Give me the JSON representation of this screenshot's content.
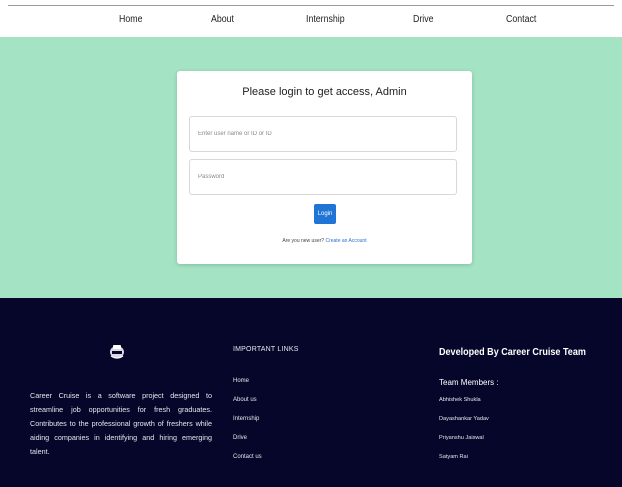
{
  "nav": {
    "items": [
      {
        "label": "Home"
      },
      {
        "label": "About"
      },
      {
        "label": "Internship"
      },
      {
        "label": "Drive"
      },
      {
        "label": "Contact"
      }
    ]
  },
  "login": {
    "title": "Please login to get access, Admin",
    "username_placeholder": "Enter user name or ID or ID",
    "password_placeholder": "Password",
    "button_label": "Login",
    "signup_prompt": "Are you new user?",
    "signup_link": "Create an Account"
  },
  "footer": {
    "logo_icon": "career-cruise-logo",
    "about_text": "Career Cruise is a software project designed to streamline job opportunities for fresh graduates. Contributes to the professional growth of freshers while aiding companies in identifying and hiring emerging talent.",
    "links_heading": "IMPORTANT LINKS",
    "links": [
      {
        "label": "Home"
      },
      {
        "label": "About us"
      },
      {
        "label": "Internship"
      },
      {
        "label": "Drive"
      },
      {
        "label": "Contact us"
      }
    ],
    "dev_heading": "Developed By Career Cruise Team",
    "team_heading": "Team Members :",
    "members": [
      "Abhishek Shukla",
      "Dayashankar Yadav",
      "Priyanshu Jaiswal",
      "Satyam Rai"
    ]
  },
  "colors": {
    "hero_bg": "#a4e3c4",
    "footer_bg": "#06062a",
    "button": "#1f74d6",
    "link": "#2a6fd0"
  }
}
